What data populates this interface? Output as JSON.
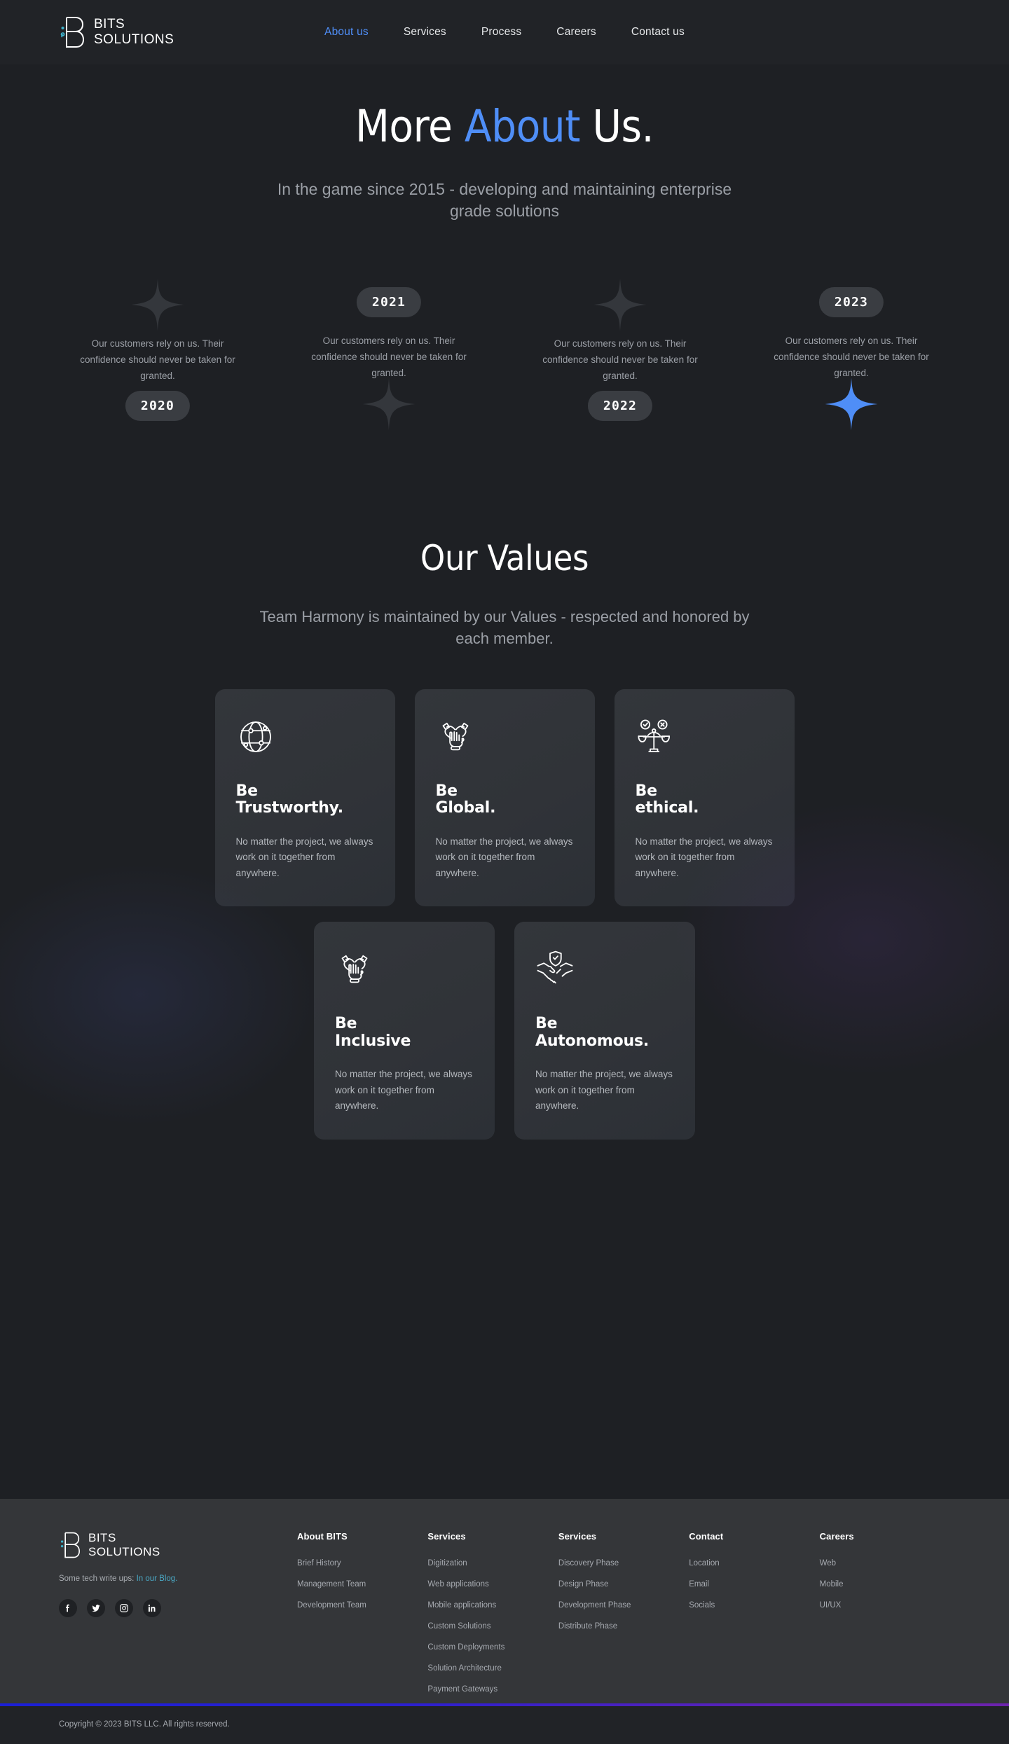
{
  "brand": {
    "line1": "BITS",
    "line2": "SOLUTIONS"
  },
  "nav": {
    "items": [
      {
        "label": "About us",
        "active": true
      },
      {
        "label": "Services",
        "active": false
      },
      {
        "label": "Process",
        "active": false
      },
      {
        "label": "Careers",
        "active": false
      },
      {
        "label": "Contact us",
        "active": false
      }
    ]
  },
  "hero": {
    "title_pre": "More ",
    "title_accent": "About",
    "title_post": " Us.",
    "subtitle": "In the game since 2015 - developing and maintaining enterprise grade solutions"
  },
  "timeline": {
    "items": [
      {
        "year": "2020",
        "text": "Our customers rely on us. Their confidence should never be taken for granted.",
        "layout": "a",
        "spark": "dim"
      },
      {
        "year": "2021",
        "text": "Our customers rely on us. Their confidence should never be taken for granted.",
        "layout": "b",
        "spark": "dim"
      },
      {
        "year": "2022",
        "text": "Our customers rely on us. Their confidence should never be taken for granted.",
        "layout": "a",
        "spark": "dim"
      },
      {
        "year": "2023",
        "text": "Our customers rely on us. Their confidence should never be taken for granted.",
        "layout": "b",
        "spark": "active"
      }
    ]
  },
  "values": {
    "heading": "Our Values",
    "subtitle": "Team Harmony is maintained by our Values - respected and honored by each member.",
    "cards_row1": [
      {
        "icon": "globe-network-icon",
        "title": "Be\nTrustworthy.",
        "desc": "No matter the project, we always work on it together from anywhere."
      },
      {
        "icon": "three-hands-icon",
        "title": "Be\nGlobal.",
        "desc": "No matter the project, we always work on it together from anywhere."
      },
      {
        "icon": "balance-scale-icon",
        "title": "Be\nethical.",
        "desc": "No matter the project, we always work on it together from anywhere."
      }
    ],
    "cards_row2": [
      {
        "icon": "three-hands-icon",
        "title": "Be\nInclusive",
        "desc": "No matter the project, we always work on it together from anywhere."
      },
      {
        "icon": "handshake-shield-icon",
        "title": "Be\nAutonomous.",
        "desc": "No matter the project, we always work on it together from anywhere."
      }
    ]
  },
  "footer": {
    "tagline_prefix": "Some tech write ups: ",
    "tagline_link": "In our Blog.",
    "socials": [
      {
        "name": "facebook-icon"
      },
      {
        "name": "twitter-icon"
      },
      {
        "name": "instagram-icon"
      },
      {
        "name": "linkedin-icon"
      }
    ],
    "columns": [
      {
        "heading": "About BITS",
        "links": [
          "Brief History",
          "Management Team",
          "Development Team"
        ]
      },
      {
        "heading": "Services",
        "links": [
          "Digitization",
          "Web applications",
          "Mobile applications",
          "Custom Solutions",
          "Custom Deployments",
          "Solution Architecture",
          "Payment Gateways"
        ]
      },
      {
        "heading": "Services",
        "links": [
          "Discovery Phase",
          "Design Phase",
          "Development Phase",
          "Distribute Phase"
        ]
      },
      {
        "heading": "Contact",
        "links": [
          "Location",
          "Email",
          "Socials"
        ]
      },
      {
        "heading": "Careers",
        "links": [
          "Web",
          "Mobile",
          "UI/UX"
        ]
      }
    ],
    "copyright": "Copyright © 2023 BITS LLC. All rights reserved."
  },
  "colors": {
    "accent_blue": "#4f8ef7",
    "link_cyan": "#4aa8c4",
    "page_bg": "#1e2024",
    "footer_bg": "#343639"
  }
}
